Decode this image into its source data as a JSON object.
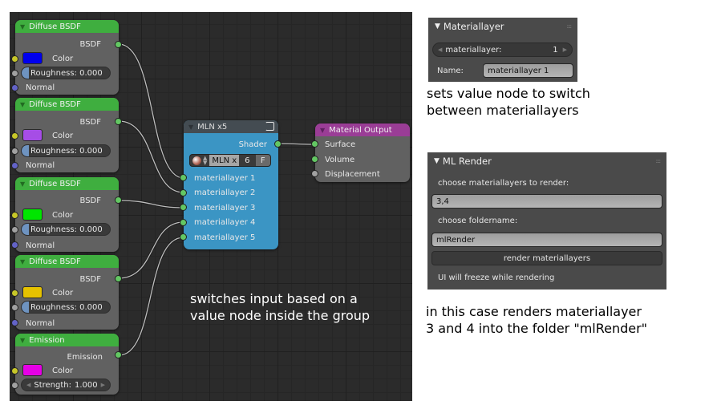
{
  "node_editor": {
    "nodes": [
      {
        "title": "Diffuse BSDF",
        "output": "BSDF",
        "color_label": "Color",
        "color": "#0000ee",
        "roughness_label": "Roughness:",
        "roughness": "0.000",
        "normal_label": "Normal"
      },
      {
        "title": "Diffuse BSDF",
        "output": "BSDF",
        "color_label": "Color",
        "color": "#a64de6",
        "roughness_label": "Roughness:",
        "roughness": "0.000",
        "normal_label": "Normal"
      },
      {
        "title": "Diffuse BSDF",
        "output": "BSDF",
        "color_label": "Color",
        "color": "#00e600",
        "roughness_label": "Roughness:",
        "roughness": "0.000",
        "normal_label": "Normal"
      },
      {
        "title": "Diffuse BSDF",
        "output": "BSDF",
        "color_label": "Color",
        "color": "#e6c200",
        "roughness_label": "Roughness:",
        "roughness": "0.000",
        "normal_label": "Normal"
      }
    ],
    "emission": {
      "title": "Emission",
      "output": "Emission",
      "color_label": "Color",
      "color": "#e600e6",
      "strength_label": "Strength:",
      "strength": "1.000"
    },
    "group": {
      "title": "MLN x5",
      "output": "Shader",
      "datablock_name": "MLN x",
      "users": "6",
      "fake_user": "F",
      "inputs": [
        "materiallayer 1",
        "materiallayer 2",
        "materiallayer 3",
        "materiallayer 4",
        "materiallayer 5"
      ],
      "color": "#3b95c4"
    },
    "output_node": {
      "title": "Material Output",
      "inputs": [
        "Surface",
        "Volume",
        "Displacement"
      ]
    },
    "annotation": [
      "switches input based on a",
      "value node inside the group"
    ]
  },
  "materiallayer_panel": {
    "title": "Materiallayer",
    "field_label": "materiallayer:",
    "field_value": "1",
    "name_label": "Name:",
    "name_value": "materiallayer 1",
    "caption": [
      "sets value node to switch",
      "between materiallayers"
    ]
  },
  "mlrender_panel": {
    "title": "ML Render",
    "layers_label": "choose materiallayers to render:",
    "layers_value": "3,4",
    "folder_label": "choose foldername:",
    "folder_value": "mlRender",
    "render_button": "render materiallayers",
    "warning": "UI will freeze while rendering",
    "caption": [
      "in this case renders materiallayer",
      "3 and 4 into the folder \"mlRender\""
    ]
  }
}
